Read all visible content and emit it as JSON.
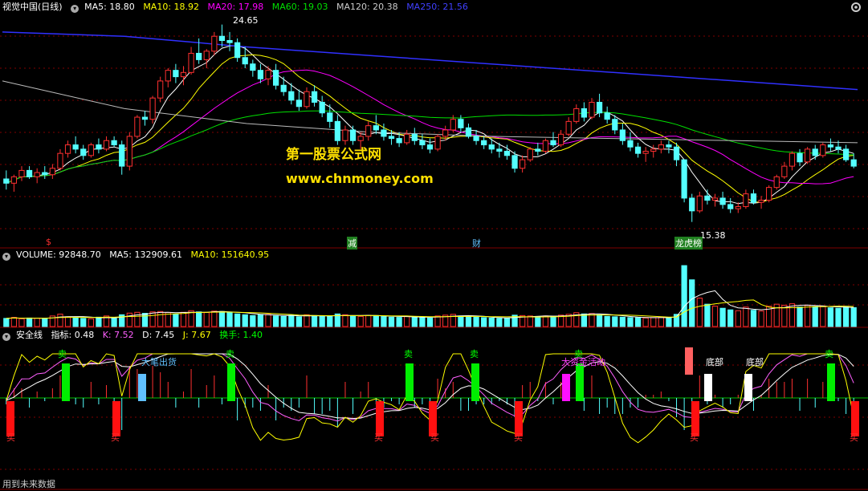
{
  "price_panel": {
    "title": "视觉中国(日线)",
    "ma": [
      {
        "label": "MA5: 18.80",
        "color": "#ffffff"
      },
      {
        "label": "MA10: 18.92",
        "color": "#ffff00"
      },
      {
        "label": "MA20: 17.98",
        "color": "#ff00ff"
      },
      {
        "label": "MA60: 19.03",
        "color": "#00e000"
      },
      {
        "label": "MA120: 20.38",
        "color": "#cccccc"
      },
      {
        "label": "MA250: 21.56",
        "color": "#4040ff"
      }
    ],
    "high_label": "24.65",
    "low_label": "15.38",
    "markers": [
      {
        "text": "$",
        "color": "#ff3030"
      },
      {
        "text": "减",
        "color": "#ffffff",
        "bg": "#208020"
      },
      {
        "text": "财",
        "color": "#60c0ff"
      },
      {
        "text": "龙虎榜",
        "color": "#ffffff",
        "bg": "#208020"
      }
    ]
  },
  "watermark": {
    "line1": "第一股票公式网",
    "line2": "www.chnmoney.com"
  },
  "volume_panel": {
    "items": [
      {
        "label": "VOLUME: 92848.70",
        "color": "#ffffff"
      },
      {
        "label": "MA5: 132909.61",
        "color": "#ffffff"
      },
      {
        "label": "MA10: 151640.95",
        "color": "#ffff00"
      }
    ]
  },
  "indicator_panel": {
    "items": [
      {
        "label": "安全线",
        "color": "#ffffff"
      },
      {
        "label": "指标: 0.48",
        "color": "#ffffff"
      },
      {
        "label": "K: 7.52",
        "color": "#ff60ff"
      },
      {
        "label": "D: 7.45",
        "color": "#ffffff"
      },
      {
        "label": "J: 7.67",
        "color": "#ffff00"
      },
      {
        "label": "换手: 1.40",
        "color": "#00ff00"
      }
    ],
    "labels": {
      "sell": "卖",
      "buy": "买",
      "big_sell": "大笔出货",
      "big_money": "大资金活动",
      "bottom": "底部"
    }
  },
  "footer": "用到未来数据",
  "colors": {
    "up": "#ff3030",
    "down": "#54ffff",
    "grid": "#800000"
  },
  "chart_data": {
    "type": "candlestick",
    "y_range": [
      14.5,
      25.2
    ],
    "ohlc": [
      [
        17.4,
        17.8,
        16.9,
        17.2
      ],
      [
        17.2,
        17.6,
        16.8,
        17.5
      ],
      [
        17.5,
        18.0,
        17.3,
        17.8
      ],
      [
        17.8,
        18.0,
        17.4,
        17.5
      ],
      [
        17.5,
        17.9,
        17.2,
        17.7
      ],
      [
        17.7,
        18.0,
        17.4,
        17.6
      ],
      [
        17.6,
        18.1,
        17.4,
        17.9
      ],
      [
        17.9,
        18.8,
        17.8,
        18.6
      ],
      [
        18.6,
        19.2,
        18.4,
        19.0
      ],
      [
        19.0,
        19.4,
        18.6,
        18.8
      ],
      [
        18.8,
        19.0,
        18.3,
        18.5
      ],
      [
        18.5,
        19.1,
        18.4,
        19.0
      ],
      [
        19.0,
        19.3,
        18.6,
        18.8
      ],
      [
        18.8,
        19.4,
        18.7,
        19.2
      ],
      [
        19.2,
        19.4,
        18.9,
        19.0
      ],
      [
        19.0,
        19.2,
        17.6,
        18.0
      ],
      [
        18.0,
        19.6,
        17.8,
        19.4
      ],
      [
        19.4,
        20.4,
        19.3,
        20.3
      ],
      [
        20.3,
        20.6,
        19.9,
        20.2
      ],
      [
        20.2,
        21.3,
        20.0,
        21.2
      ],
      [
        21.2,
        22.2,
        21.0,
        22.0
      ],
      [
        22.0,
        22.6,
        21.7,
        22.5
      ],
      [
        22.5,
        22.8,
        21.9,
        22.2
      ],
      [
        22.2,
        22.7,
        21.8,
        22.4
      ],
      [
        22.4,
        23.6,
        22.3,
        23.3
      ],
      [
        23.3,
        24.0,
        22.8,
        23.0
      ],
      [
        23.0,
        23.5,
        22.6,
        23.4
      ],
      [
        23.4,
        24.3,
        23.2,
        24.1
      ],
      [
        24.1,
        24.65,
        23.6,
        23.9
      ],
      [
        23.9,
        24.3,
        23.4,
        23.8
      ],
      [
        23.8,
        24.0,
        22.9,
        23.1
      ],
      [
        23.1,
        23.6,
        22.6,
        22.8
      ],
      [
        22.8,
        23.0,
        22.2,
        22.5
      ],
      [
        22.5,
        22.8,
        21.9,
        22.1
      ],
      [
        22.1,
        22.7,
        21.8,
        22.5
      ],
      [
        22.5,
        22.8,
        21.6,
        21.8
      ],
      [
        21.8,
        22.2,
        21.3,
        21.5
      ],
      [
        21.5,
        21.9,
        20.9,
        21.1
      ],
      [
        21.1,
        21.6,
        20.6,
        20.8
      ],
      [
        20.8,
        21.7,
        20.7,
        21.5
      ],
      [
        21.5,
        21.8,
        20.8,
        21.0
      ],
      [
        21.0,
        21.3,
        20.3,
        20.5
      ],
      [
        20.5,
        20.9,
        19.8,
        20.1
      ],
      [
        20.1,
        20.4,
        19.0,
        19.2
      ],
      [
        19.2,
        19.9,
        19.0,
        19.7
      ],
      [
        19.7,
        19.9,
        19.0,
        19.2
      ],
      [
        19.2,
        19.6,
        18.8,
        19.4
      ],
      [
        19.4,
        20.1,
        19.2,
        19.9
      ],
      [
        19.9,
        20.4,
        19.5,
        19.7
      ],
      [
        19.7,
        20.0,
        19.2,
        19.4
      ],
      [
        19.4,
        19.7,
        19.0,
        19.3
      ],
      [
        19.3,
        19.6,
        18.9,
        19.1
      ],
      [
        19.1,
        19.7,
        19.0,
        19.5
      ],
      [
        19.5,
        19.8,
        19.0,
        19.2
      ],
      [
        19.2,
        19.5,
        18.8,
        19.0
      ],
      [
        19.0,
        19.3,
        18.6,
        18.8
      ],
      [
        18.8,
        19.5,
        18.7,
        19.4
      ],
      [
        19.4,
        19.9,
        19.2,
        19.7
      ],
      [
        19.7,
        20.4,
        19.6,
        20.2
      ],
      [
        20.2,
        20.4,
        19.6,
        19.8
      ],
      [
        19.8,
        20.0,
        19.3,
        19.4
      ],
      [
        19.4,
        19.7,
        19.0,
        19.2
      ],
      [
        19.2,
        19.4,
        18.8,
        19.0
      ],
      [
        19.0,
        19.3,
        18.6,
        18.8
      ],
      [
        18.8,
        19.1,
        18.4,
        18.7
      ],
      [
        18.7,
        19.0,
        18.3,
        18.5
      ],
      [
        18.5,
        18.7,
        17.7,
        17.9
      ],
      [
        17.9,
        18.5,
        17.7,
        18.3
      ],
      [
        18.3,
        18.9,
        18.2,
        18.8
      ],
      [
        18.8,
        19.1,
        18.5,
        18.7
      ],
      [
        18.7,
        19.3,
        18.6,
        19.2
      ],
      [
        19.2,
        19.6,
        18.9,
        19.0
      ],
      [
        19.0,
        19.7,
        18.9,
        19.5
      ],
      [
        19.5,
        20.3,
        19.4,
        20.1
      ],
      [
        20.1,
        20.9,
        20.0,
        20.7
      ],
      [
        20.7,
        21.0,
        20.1,
        20.3
      ],
      [
        20.3,
        21.2,
        20.2,
        21.0
      ],
      [
        21.0,
        21.4,
        20.3,
        20.5
      ],
      [
        20.5,
        20.8,
        20.0,
        20.2
      ],
      [
        20.2,
        20.4,
        19.5,
        19.7
      ],
      [
        19.7,
        20.0,
        19.0,
        19.2
      ],
      [
        19.2,
        19.6,
        18.7,
        18.9
      ],
      [
        18.9,
        19.1,
        18.4,
        18.6
      ],
      [
        18.6,
        18.9,
        18.2,
        18.7
      ],
      [
        18.7,
        19.0,
        18.4,
        18.8
      ],
      [
        18.8,
        19.2,
        18.6,
        19.0
      ],
      [
        19.0,
        19.2,
        18.6,
        18.9
      ],
      [
        18.9,
        19.1,
        18.0,
        18.3
      ],
      [
        18.3,
        17.0,
        16.3,
        16.5
      ],
      [
        16.5,
        16.7,
        15.38,
        15.9
      ],
      [
        15.9,
        16.8,
        15.8,
        16.6
      ],
      [
        16.6,
        16.9,
        16.2,
        16.4
      ],
      [
        16.4,
        16.7,
        16.1,
        16.5
      ],
      [
        16.5,
        16.8,
        16.0,
        16.2
      ],
      [
        16.2,
        16.5,
        15.8,
        16.0
      ],
      [
        16.0,
        16.3,
        15.8,
        16.1
      ],
      [
        16.1,
        16.9,
        16.0,
        16.7
      ],
      [
        16.7,
        16.9,
        16.2,
        16.3
      ],
      [
        16.3,
        16.6,
        16.0,
        16.4
      ],
      [
        16.4,
        17.1,
        16.3,
        17.0
      ],
      [
        17.0,
        17.6,
        16.9,
        17.5
      ],
      [
        17.5,
        18.2,
        17.4,
        18.0
      ],
      [
        18.0,
        18.7,
        17.8,
        18.6
      ],
      [
        18.6,
        18.8,
        18.0,
        18.2
      ],
      [
        18.2,
        18.9,
        18.1,
        18.8
      ],
      [
        18.8,
        19.0,
        18.3,
        18.5
      ],
      [
        18.5,
        19.1,
        18.4,
        19.0
      ],
      [
        19.0,
        19.3,
        18.7,
        18.9
      ],
      [
        18.9,
        19.2,
        18.6,
        18.8
      ],
      [
        18.8,
        19.0,
        18.2,
        18.3
      ],
      [
        18.3,
        18.6,
        17.9,
        18.0
      ]
    ],
    "volume_range": [
      0,
      320000
    ],
    "volume": [
      40000,
      45000,
      38000,
      42000,
      41000,
      39000,
      52000,
      61000,
      48000,
      44000,
      40000,
      38000,
      46000,
      52000,
      40000,
      58000,
      66000,
      70000,
      65000,
      72000,
      74000,
      69000,
      61000,
      70000,
      78000,
      72000,
      69000,
      76000,
      74000,
      70000,
      62000,
      58000,
      54000,
      57000,
      60000,
      52000,
      50000,
      55000,
      48000,
      58000,
      54000,
      50000,
      49000,
      62000,
      58000,
      52000,
      50000,
      55000,
      54000,
      49000,
      46000,
      45000,
      50000,
      48000,
      44000,
      42000,
      52000,
      56000,
      60000,
      52000,
      48000,
      46000,
      44000,
      42000,
      40000,
      40000,
      56000,
      54000,
      52000,
      48000,
      52000,
      50000,
      56000,
      60000,
      68000,
      62000,
      64000,
      58000,
      50000,
      48000,
      46000,
      44000,
      43000,
      42000,
      44000,
      46000,
      45000,
      60000,
      300000,
      230000,
      140000,
      110000,
      100000,
      90000,
      82000,
      78000,
      96000,
      80000,
      76000,
      100000,
      110000,
      105000,
      112000,
      96000,
      104000,
      98000,
      100000,
      92000,
      90000,
      96000,
      92848
    ]
  }
}
